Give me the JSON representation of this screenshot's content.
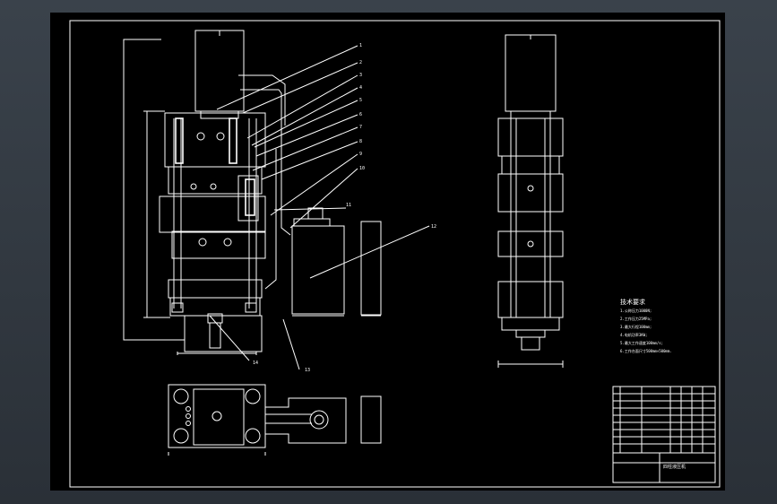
{
  "drawing": {
    "background_color": "#000000",
    "line_color": "#ffffff",
    "viewport_color": "#333a42"
  },
  "callouts": [
    "1",
    "2",
    "3",
    "4",
    "5",
    "6",
    "7",
    "8",
    "9",
    "10",
    "11",
    "12",
    "13",
    "14"
  ],
  "tech_req": {
    "title": "技术要求",
    "items": [
      "1.公称压力1000N;",
      "2.工作压力25MPa;",
      "3.最大行程100mm;",
      "4.电机功率3KW;",
      "5.最大工作速度100mm/s;",
      "6.工作台面尺寸500mm×500mm."
    ]
  },
  "title_block": {
    "project": "四柱液压机",
    "rows": [
      "",
      "",
      "",
      "",
      "",
      "",
      ""
    ]
  }
}
